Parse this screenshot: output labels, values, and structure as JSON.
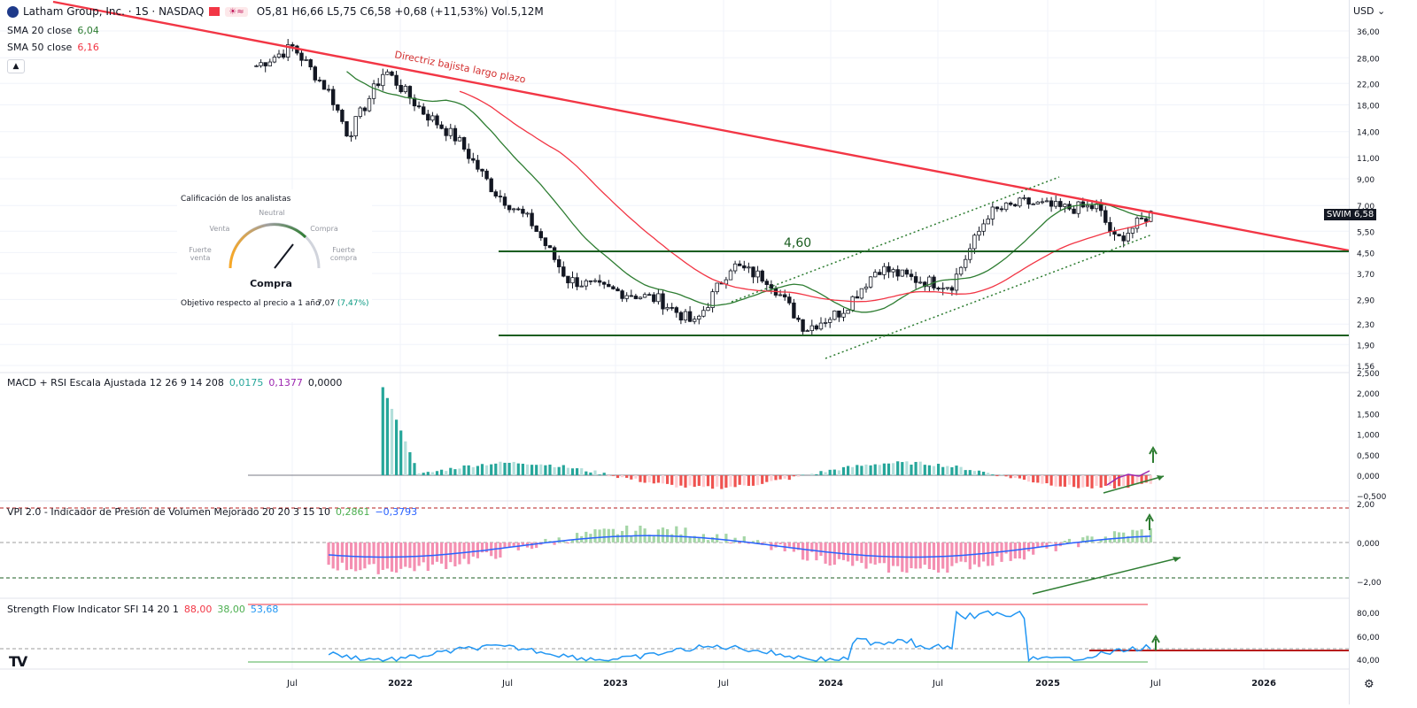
{
  "header": {
    "symbol_title": "Latham Group, Inc. · 1S · NASDAQ",
    "ohlc": "O5,81 H6,66 L5,75 C6,58 +0,68 (+11,53%) Vol.5,12M",
    "weather_badge": "☀≈"
  },
  "legends": {
    "sma20": {
      "name": "SMA 20 close",
      "value": "6,04",
      "color": "#2e7d32"
    },
    "sma50": {
      "name": "SMA 50 close",
      "value": "6,16",
      "color": "#f23645"
    },
    "macd": {
      "name": "MACD + RSI Escala Ajustada 12 26 9 14 208",
      "v1": "0,0175",
      "v2": "0,1377",
      "v3": "0,0000"
    },
    "vpi": {
      "name": "VPI 2.0 - Indicador de Presión de Volumen Mejorado 20 20 3 15 10",
      "v1": "0,2861",
      "v2": "−0,3793"
    },
    "sfi": {
      "name": "Strength Flow Indicator SFI 14 20 1",
      "v1": "88,00",
      "v2": "38,00",
      "v3": "53,68"
    }
  },
  "analyst_widget": {
    "title": "Calificación de los analistas",
    "labels": {
      "neutral": "Neutral",
      "sell": "Venta",
      "buy": "Compra",
      "strong_sell": "Fuerte venta",
      "strong_buy": "Fuerte compra"
    },
    "result": "Compra",
    "target_label": "Objetivo respecto al precio a 1 año",
    "target_value": "7,07",
    "target_change": "(7,47%)"
  },
  "axis": {
    "currency": "USD",
    "price_ticks": [
      "36,00",
      "28,00",
      "22,00",
      "18,00",
      "14,00",
      "11,00",
      "9,00",
      "7,00",
      "5,50",
      "4,50",
      "3,70",
      "2,90",
      "2,30",
      "1,90",
      "1,56"
    ],
    "macd_ticks": [
      "2,500",
      "2,000",
      "1,500",
      "1,000",
      "0,500",
      "0,000",
      "−0,500"
    ],
    "vpi_ticks": [
      "2,00",
      "0,000",
      "−2,00"
    ],
    "sfi_ticks": [
      "80,00",
      "60,00",
      "40,00"
    ],
    "time_ticks": [
      "Jul",
      "2022",
      "Jul",
      "2023",
      "Jul",
      "2024",
      "Jul",
      "2025",
      "Jul",
      "2026"
    ],
    "last_price_tag": {
      "symbol": "SWIM",
      "value": "6,58"
    }
  },
  "annotations": {
    "trendline_label": "Directriz bajista largo plazo",
    "support_label": "4,60"
  },
  "colors": {
    "trendline": "#f23645",
    "support": "#1b5e20",
    "sma20": "#2e7d32",
    "sma50": "#f23645",
    "hist_pos": "#26a69a",
    "hist_neg": "#ef5350",
    "vpi_line": "#2962ff",
    "sfi_line": "#2196f3"
  },
  "chart_data": {
    "type": "candlestick",
    "title": "Latham Group, Inc. (SWIM) weekly",
    "price_weekly_close_approx": [
      {
        "date": "2021-05",
        "close": 26.0
      },
      {
        "date": "2021-07",
        "close": 31.0
      },
      {
        "date": "2021-09",
        "close": 20.0
      },
      {
        "date": "2021-10",
        "close": 13.5
      },
      {
        "date": "2021-12",
        "close": 25.0
      },
      {
        "date": "2022-02",
        "close": 17.0
      },
      {
        "date": "2022-04",
        "close": 13.0
      },
      {
        "date": "2022-06",
        "close": 8.0
      },
      {
        "date": "2022-08",
        "close": 6.0
      },
      {
        "date": "2022-10",
        "close": 3.5
      },
      {
        "date": "2022-12",
        "close": 3.2
      },
      {
        "date": "2023-03",
        "close": 2.9
      },
      {
        "date": "2023-05",
        "close": 2.3
      },
      {
        "date": "2023-07",
        "close": 4.0
      },
      {
        "date": "2023-09",
        "close": 3.5
      },
      {
        "date": "2023-11",
        "close": 2.2
      },
      {
        "date": "2024-01",
        "close": 2.6
      },
      {
        "date": "2024-03",
        "close": 3.9
      },
      {
        "date": "2024-05",
        "close": 3.5
      },
      {
        "date": "2024-07",
        "close": 3.3
      },
      {
        "date": "2024-09",
        "close": 6.5
      },
      {
        "date": "2024-11",
        "close": 7.2
      },
      {
        "date": "2025-01",
        "close": 6.8
      },
      {
        "date": "2025-03",
        "close": 6.9
      },
      {
        "date": "2025-04",
        "close": 5.0
      },
      {
        "date": "2025-06",
        "close": 6.58
      }
    ],
    "support_levels": [
      4.6,
      2.15
    ],
    "legend_placement": "top-left",
    "grid": true
  }
}
